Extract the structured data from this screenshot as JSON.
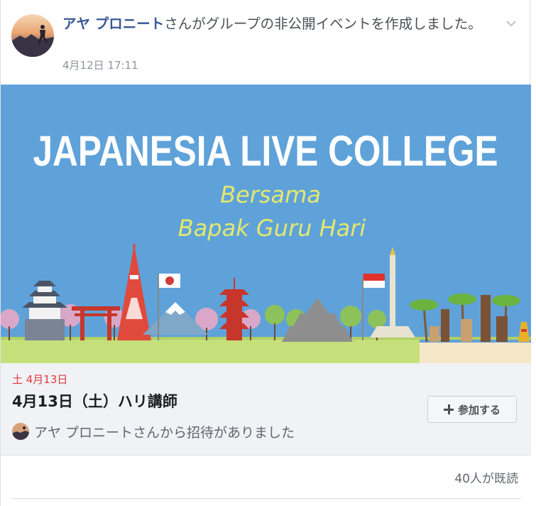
{
  "post": {
    "author": "アヤ プロニート",
    "action_text": "さんがグループの非公開イベントを作成しました。",
    "timestamp": "4月12日 17:11"
  },
  "banner": {
    "title": "JAPANESIA LIVE COLLEGE",
    "subtitle_line1": "Bersama",
    "subtitle_line2": "Bapak Guru Hari",
    "colors": {
      "sky": "#5fa2d9",
      "title": "#ffffff",
      "subtitle": "#e3e870",
      "ground": "#c5e07a"
    }
  },
  "event": {
    "date": "土 4月13日",
    "title": "4月13日（土）ハリ講師",
    "invite_text": "アヤ プロニートさんから招待がありました",
    "join_label": "参加する"
  },
  "footer": {
    "seen_text": "40人が既読"
  },
  "colors": {
    "author_link": "#385898",
    "date_accent": "#e0393e"
  }
}
